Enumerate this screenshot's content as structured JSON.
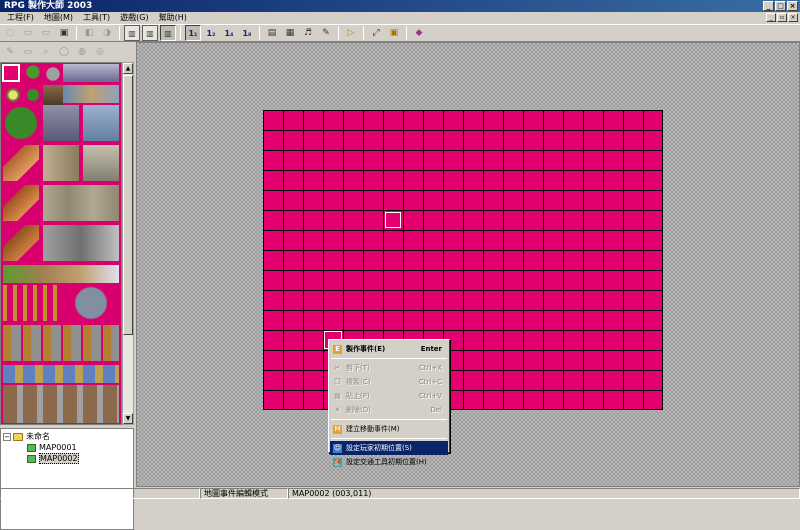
{
  "window": {
    "title": "RPG 製作大師 2003"
  },
  "menu": [
    "工程(F)",
    "地圖(M)",
    "工具(T)",
    "遊戲(G)",
    "幫助(H)"
  ],
  "toolbar": {
    "layer_buttons": [
      "1₁",
      "1₂",
      "1₄",
      "1₈"
    ]
  },
  "tree": {
    "root": "未命名",
    "maps": [
      "MAP0001",
      "MAP0002"
    ],
    "selected": "MAP0002"
  },
  "context_menu": {
    "items": [
      {
        "label": "製作事件(E)",
        "shortcut": "Enter",
        "enabled": true,
        "bold": true,
        "icon": "event-icon"
      },
      {
        "label": "剪下(T)",
        "shortcut": "Ctrl+X",
        "enabled": false,
        "icon": "cut-icon"
      },
      {
        "label": "複製(C)",
        "shortcut": "Ctrl+C",
        "enabled": false,
        "icon": "copy-icon"
      },
      {
        "label": "貼上(P)",
        "shortcut": "Ctrl+V",
        "enabled": false,
        "icon": "paste-icon"
      },
      {
        "label": "刪除(D)",
        "shortcut": "Del",
        "enabled": false,
        "icon": "delete-icon"
      },
      {
        "label": "建立移動事件(M)",
        "shortcut": "",
        "enabled": true,
        "icon": "move-event-icon"
      },
      {
        "label": "設定玩家初期位置(S)",
        "shortcut": "",
        "enabled": true,
        "highlight": true,
        "icon": "player-start-icon"
      },
      {
        "label": "設定交通工具初期位置(H)",
        "shortcut": "",
        "enabled": true,
        "icon": "vehicle-start-icon"
      }
    ]
  },
  "status": {
    "mode": "地圖事件編輯模式",
    "position": "MAP0002 (003,011)"
  },
  "colors": {
    "map_fill": "#e5006f",
    "tileset_bg": "#d8006f",
    "highlight": "#0a246a"
  }
}
